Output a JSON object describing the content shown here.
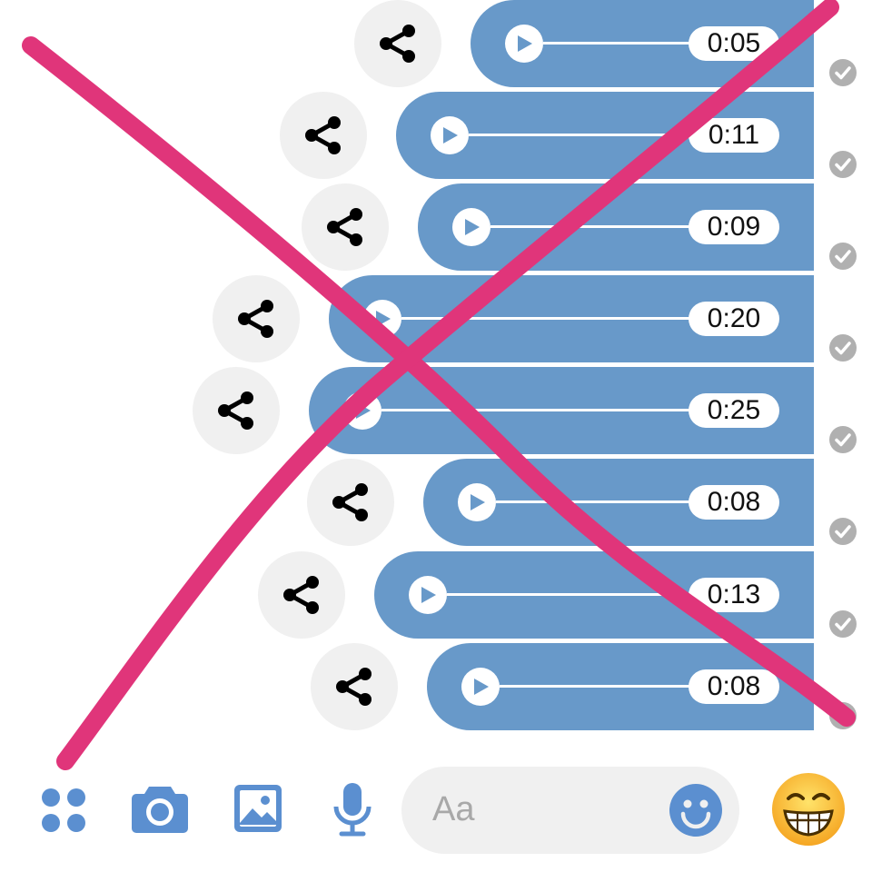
{
  "messages": [
    {
      "duration": "0:05"
    },
    {
      "duration": "0:11"
    },
    {
      "duration": "0:09"
    },
    {
      "duration": "0:20"
    },
    {
      "duration": "0:25"
    },
    {
      "duration": "0:08"
    },
    {
      "duration": "0:13"
    },
    {
      "duration": "0:08"
    }
  ],
  "composer": {
    "placeholder": "Aa",
    "icons": [
      "apps-grid-icon",
      "camera-icon",
      "image-icon",
      "microphone-icon",
      "smiley-icon",
      "grinning-emoji-icon"
    ]
  },
  "colors": {
    "bubble": "#6899c9",
    "accent": "#5b8fd0",
    "strike": "#e0357a",
    "check": "#b0b0b0"
  },
  "icons": {
    "share": "share-icon",
    "play": "play-icon",
    "check": "sent-check-icon",
    "overlay": "strike-x-overlay"
  }
}
